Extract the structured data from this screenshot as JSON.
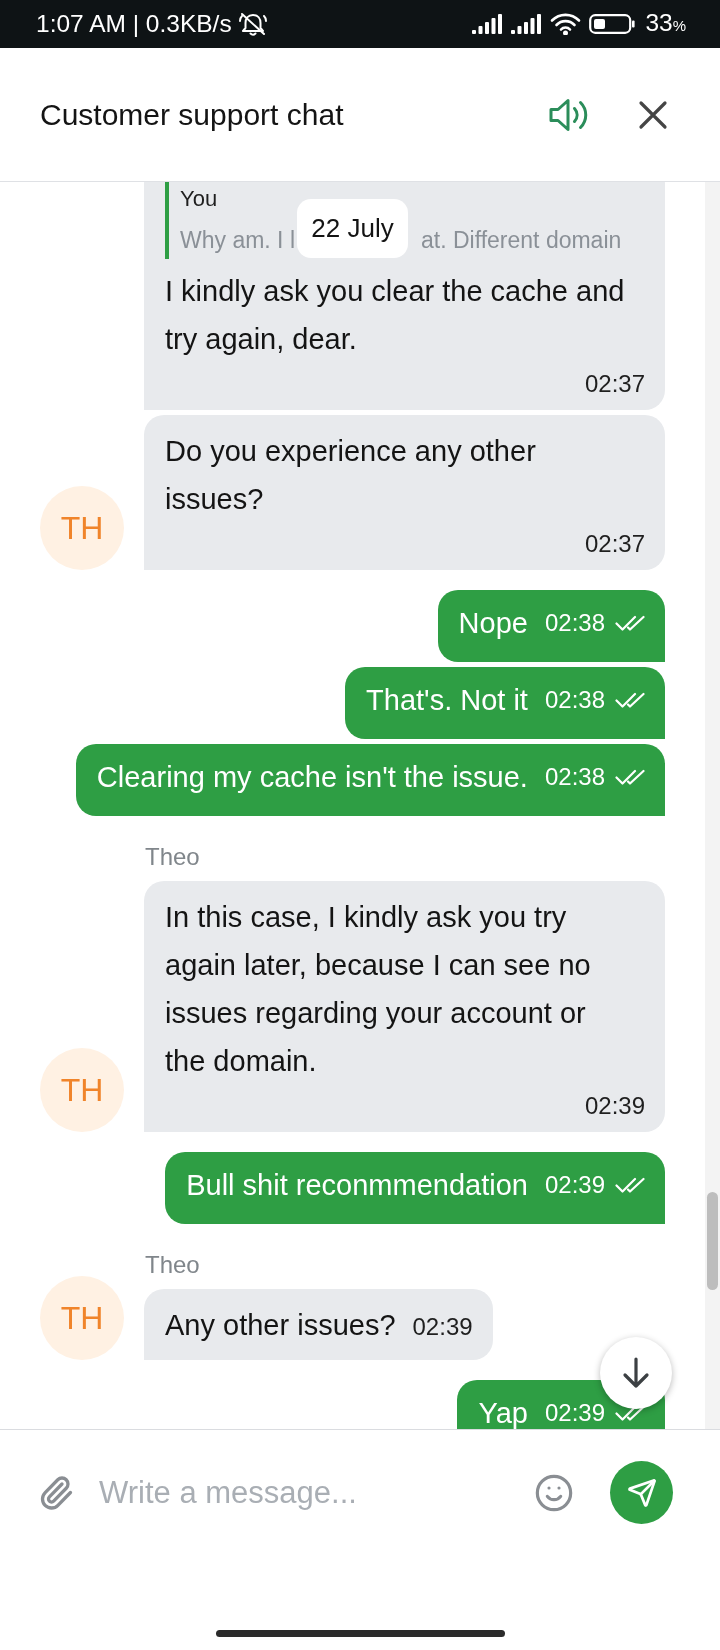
{
  "status_bar": {
    "time": "1:07 AM | 0.3KB/s",
    "battery": {
      "value": "33",
      "unit": "%"
    }
  },
  "header": {
    "title": "Customer support chat",
    "sound_on": true
  },
  "date_badge": "22 July",
  "messages": [
    {
      "kind": "received",
      "quote": {
        "author": "You",
        "visible_parts": [
          "Why am. I l",
          "at. Different domain"
        ]
      },
      "text": "I kindly ask you clear the cache and try again, dear.",
      "time": "02:37"
    },
    {
      "kind": "received",
      "avatar": "TH",
      "text": "Do you experience any other issues?",
      "time": "02:37"
    },
    {
      "kind": "sent",
      "text": "Nope",
      "time": "02:38",
      "read": true
    },
    {
      "kind": "sent",
      "text": "That's. Not it",
      "time": "02:38",
      "read": true
    },
    {
      "kind": "sent",
      "text": "Clearing my cache isn't the issue.",
      "time": "02:38",
      "read": true
    },
    {
      "kind": "received",
      "sender": "Theo",
      "avatar": "TH",
      "text": "In this case, I kindly ask you try again later, because I can see no issues regarding your account or the domain.",
      "time": "02:39"
    },
    {
      "kind": "sent",
      "text": "Bull shit reconmmendation",
      "time": "02:39",
      "read": true
    },
    {
      "kind": "received",
      "sender": "Theo",
      "avatar": "TH",
      "text": "Any other issues?",
      "time": "02:39"
    },
    {
      "kind": "sent",
      "text": "Yap",
      "time": "02:39",
      "read": true
    }
  ],
  "composer": {
    "placeholder": "Write a message..."
  }
}
